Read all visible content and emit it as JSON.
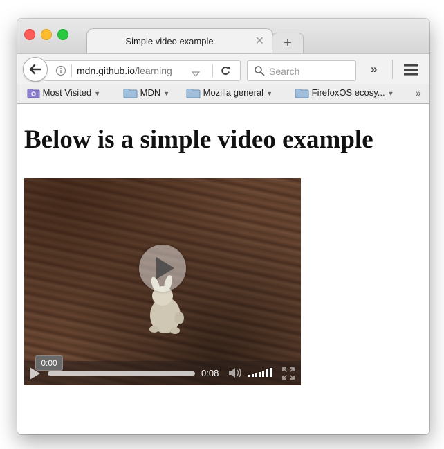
{
  "window": {
    "tab_title": "Simple video example",
    "tab_close_icon": "close-icon",
    "new_tab_label": "+"
  },
  "navbar": {
    "url_host": "mdn.github.io",
    "url_path": "/learning",
    "search_placeholder": "Search",
    "overflow_label": "»"
  },
  "bookmarks": [
    {
      "label": "Most Visited",
      "icon": "gear-folder-icon"
    },
    {
      "label": "MDN",
      "icon": "folder-icon"
    },
    {
      "label": "Mozilla general",
      "icon": "folder-icon"
    },
    {
      "label": "FirefoxOS ecosy...",
      "icon": "folder-icon"
    }
  ],
  "bookmarks_more": "»",
  "page": {
    "heading": "Below is a simple video example"
  },
  "video": {
    "current_time": "0:00",
    "duration": "0:08",
    "progress": 0
  },
  "colors": {
    "close": "#fc5e57",
    "minimize": "#fdbc2e",
    "maximize": "#2ac840",
    "folder": "#9fbfdd"
  }
}
